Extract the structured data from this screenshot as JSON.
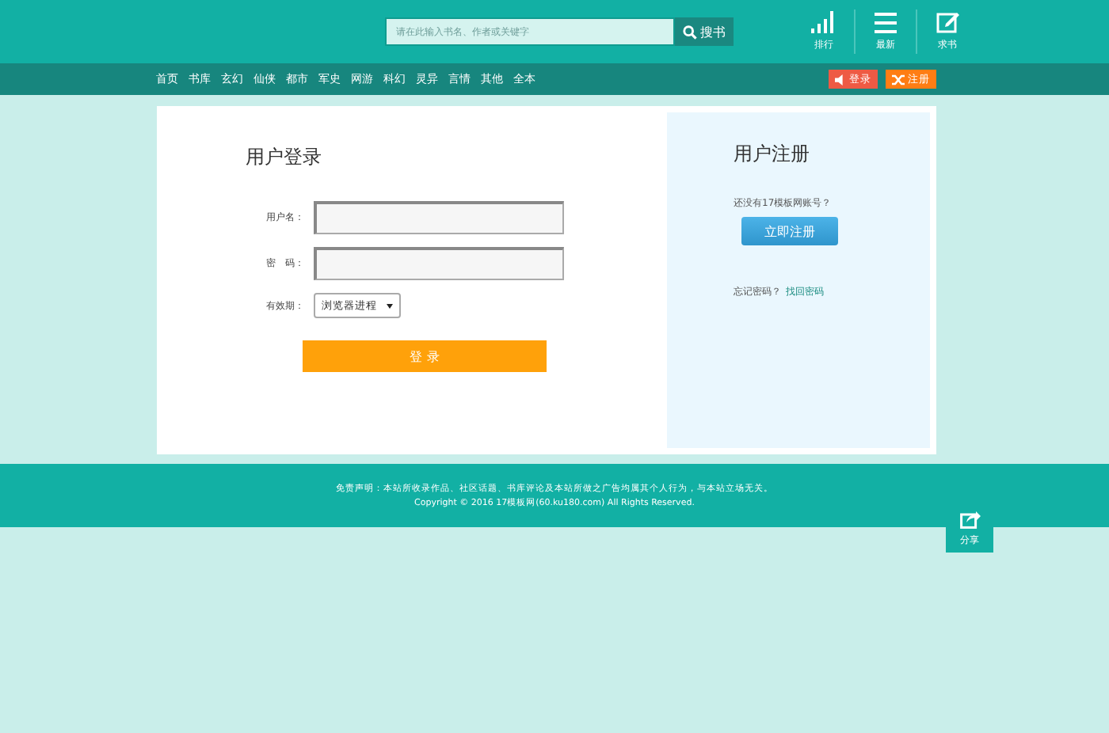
{
  "search": {
    "placeholder": "请在此输入书名、作者或关键字",
    "button": "搜书"
  },
  "header_links": [
    {
      "label": "排行",
      "kind": "ranking"
    },
    {
      "label": "最新",
      "kind": "latest"
    },
    {
      "label": "求书",
      "kind": "request"
    }
  ],
  "nav": [
    "首页",
    "书库",
    "玄幻",
    "仙侠",
    "都市",
    "军史",
    "网游",
    "科幻",
    "灵异",
    "言情",
    "其他",
    "全本"
  ],
  "auth_buttons": [
    {
      "label": "登录",
      "kind": "login"
    },
    {
      "label": "注册",
      "kind": "register"
    }
  ],
  "login": {
    "title": "用户登录",
    "fields": [
      {
        "label": "用户名："
      },
      {
        "label": "密　码："
      }
    ],
    "expiry_label": "有效期：",
    "expiry_value": "浏览器进程",
    "submit": "登 录"
  },
  "register": {
    "title": "用户注册",
    "prompt": "还没有17模板网账号？",
    "button": "立即注册",
    "forgot": "忘记密码？",
    "recover": "找回密码"
  },
  "footer": {
    "disclaimer": "免责声明：本站所收录作品、社区话题、书库评论及本站所做之广告均属其个人行为，与本站立场无关。",
    "copyright": "Copyright © 2016 17模板网(60.ku180.com) All Rights Reserved."
  },
  "share": {
    "label": "分享"
  }
}
